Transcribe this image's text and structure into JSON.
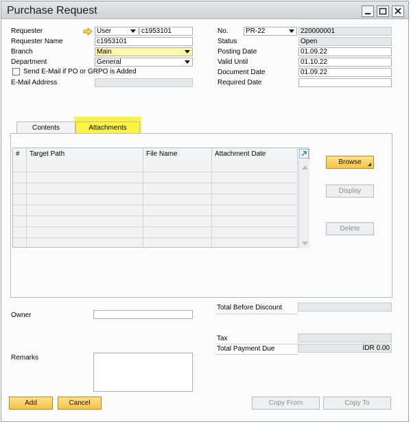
{
  "window": {
    "title": "Purchase Request"
  },
  "left_fields": {
    "requester_label": "Requester",
    "requester_type": "User",
    "requester_code": "c1953101",
    "requester_name_label": "Requester Name",
    "requester_name": "c1953101",
    "branch_label": "Branch",
    "branch": "Main",
    "department_label": "Department",
    "department": "General",
    "send_email_label": "Send E-Mail if PO or GRPO is Added",
    "email_label": "E-Mail Address",
    "email": ""
  },
  "right_fields": {
    "no_label": "No.",
    "series": "PR-22",
    "number": "220000001",
    "status_label": "Status",
    "status": "Open",
    "posting_date_label": "Posting Date",
    "posting_date": "01.09.22",
    "valid_until_label": "Valid Until",
    "valid_until": "01.10.22",
    "document_date_label": "Document Date",
    "document_date": "01.09.22",
    "required_date_label": "Required Date",
    "required_date": ""
  },
  "tabs": [
    {
      "label": "Contents"
    },
    {
      "label": "Attachments"
    }
  ],
  "attachments_table": {
    "headers": [
      "#",
      "Target Path",
      "File Name",
      "Attachment Date"
    ]
  },
  "side_buttons": {
    "browse": "Browse",
    "display": "Display",
    "delete": "Delete"
  },
  "footer": {
    "owner_label": "Owner",
    "owner": "",
    "remarks_label": "Remarks",
    "remarks": "",
    "total_before_discount_label": "Total Before Discount",
    "total_before_discount": "",
    "tax_label": "Tax",
    "tax": "",
    "total_payment_due_label": "Total Payment Due",
    "total_payment_due": "IDR 0.00"
  },
  "bottom_buttons": {
    "add": "Add",
    "cancel": "Cancel",
    "copy_from": "Copy From",
    "copy_to": "Copy To"
  },
  "colors": {
    "accent_button": "#f6c445",
    "highlight": "#fff200",
    "mandatory_field": "#fff7a8"
  }
}
